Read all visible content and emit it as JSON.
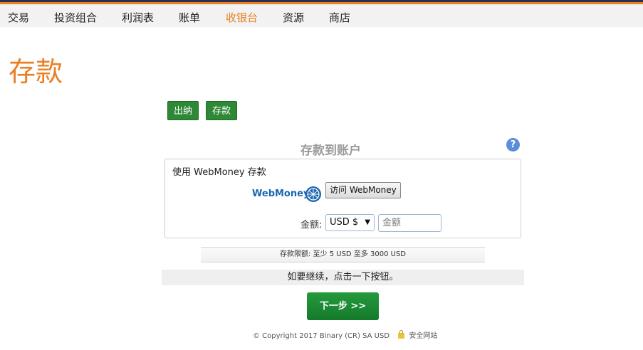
{
  "nav": {
    "items": [
      {
        "label": "交易"
      },
      {
        "label": "投资组合"
      },
      {
        "label": "利润表"
      },
      {
        "label": "账单"
      },
      {
        "label": "收银台"
      },
      {
        "label": "资源"
      },
      {
        "label": "商店"
      }
    ],
    "active": "收银台"
  },
  "page": {
    "title": "存款"
  },
  "tabs": {
    "withdraw": "出纳",
    "deposit": "存款"
  },
  "section": {
    "title": "存款到账户",
    "help_icon": "question-icon",
    "help_glyph": "?"
  },
  "payment": {
    "heading": "使用 WebMoney 存款",
    "provider_logo": "WebMoney",
    "visit_button": "访问 WebMoney",
    "amount_label": "金额:",
    "currency": "USD $",
    "amount_placeholder": "金额"
  },
  "limits": {
    "text": "存款限额: 至少 5 USD   至多 3000 USD"
  },
  "continue": {
    "text": "如要继续，点击一下按钮。"
  },
  "next_button": "下一步 >>",
  "footer": {
    "copyright": "© Copyright 2017 Binary (CR) SA USD",
    "secure": "安全网站"
  },
  "colors": {
    "accent": "#e98024",
    "button_green": "#2e8836",
    "topbar_dark": "#2a3052",
    "link_blue": "#1b66b1"
  }
}
